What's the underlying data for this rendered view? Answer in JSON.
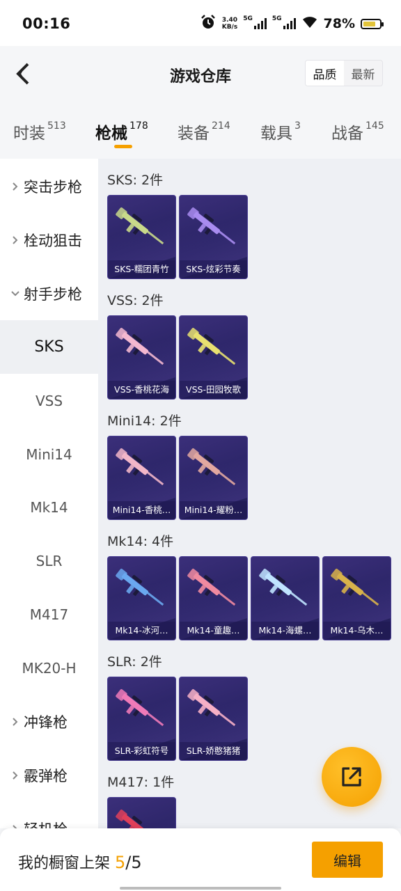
{
  "status_bar": {
    "time": "00:16",
    "speed_value": "3.40",
    "speed_unit": "KB/s",
    "net1": "5G",
    "net2": "5G",
    "battery": "78%",
    "battery_level": 0.78
  },
  "header": {
    "title": "游戏仓库",
    "sort_options": [
      "品质",
      "最新"
    ],
    "sort_selected": "品质"
  },
  "category_tabs": [
    {
      "label": "时装",
      "count": "513"
    },
    {
      "label": "枪械",
      "count": "178",
      "active": true
    },
    {
      "label": "装备",
      "count": "214"
    },
    {
      "label": "载具",
      "count": "3"
    },
    {
      "label": "战备",
      "count": "145"
    }
  ],
  "sidebar": {
    "groups": [
      {
        "label": "突击步枪",
        "expanded": false
      },
      {
        "label": "栓动狙击",
        "expanded": false
      },
      {
        "label": "射手步枪",
        "expanded": true
      }
    ],
    "sub_items": [
      "SKS",
      "VSS",
      "Mini14",
      "Mk14",
      "SLR",
      "M417",
      "MK20-H"
    ],
    "selected": "SKS",
    "more_groups": [
      "冲锋枪",
      "霰弹枪",
      "轻机枪"
    ]
  },
  "sections": [
    {
      "title": "SKS: 2件",
      "items": [
        {
          "name": "SKS-糯团青竹",
          "color": "#c9d98a"
        },
        {
          "name": "SKS-炫彩节奏",
          "color": "#a98cf0"
        }
      ]
    },
    {
      "title": "VSS: 2件",
      "items": [
        {
          "name": "VSS-香桃花海",
          "color": "#f4b8d0"
        },
        {
          "name": "VSS-田园牧歌",
          "color": "#e8e070"
        }
      ]
    },
    {
      "title": "Mini14: 2件",
      "items": [
        {
          "name": "Mini14-香桃…",
          "color": "#f2b6c8"
        },
        {
          "name": "Mini14-耀粉…",
          "color": "#e2a8a0"
        }
      ]
    },
    {
      "title": "Mk14: 4件",
      "items": [
        {
          "name": "Mk14-冰河…",
          "color": "#6aa8f0"
        },
        {
          "name": "Mk14-童趣…",
          "color": "#f08aa0"
        },
        {
          "name": "Mk14-海螺…",
          "color": "#c0e4ff"
        },
        {
          "name": "Mk14-乌木…",
          "color": "#d8b24a"
        }
      ]
    },
    {
      "title": "SLR: 2件",
      "items": [
        {
          "name": "SLR-彩虹符号",
          "color": "#f07ab8"
        },
        {
          "name": "SLR-娇憨猪猪",
          "color": "#f6b0c6"
        }
      ]
    },
    {
      "title": "M417: 1件",
      "items": [
        {
          "name": "",
          "color": "#e0405a"
        }
      ]
    }
  ],
  "bottom": {
    "shelf_label": "我的橱窗上架",
    "shelf_current": "5",
    "shelf_separator": "/",
    "shelf_total": "5",
    "edit_label": "编辑"
  },
  "icons": {
    "back": "chevron-left-icon",
    "fab": "share-icon",
    "alarm": "alarm-icon",
    "wifi": "wifi-icon",
    "battery": "battery-icon"
  },
  "colors": {
    "accent": "#f5a000",
    "card_bg": "#2a2466"
  }
}
